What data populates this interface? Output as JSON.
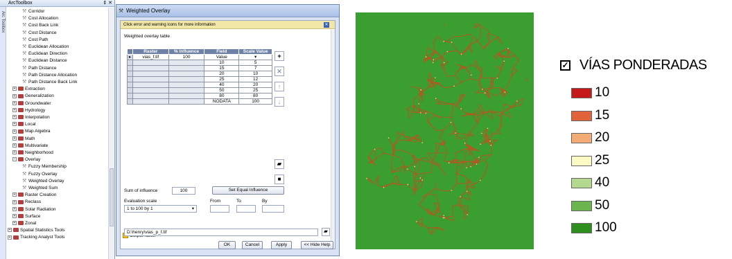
{
  "toolbox": {
    "title": "ArcToolbox",
    "pin": "⇕ ✕",
    "side_tab": "Arc Toolbox",
    "items": [
      {
        "label": "Corridor",
        "level": 2,
        "kind": "tool"
      },
      {
        "label": "Cost Allocation",
        "level": 2,
        "kind": "tool"
      },
      {
        "label": "Cost Back Link",
        "level": 2,
        "kind": "tool"
      },
      {
        "label": "Cost Distance",
        "level": 2,
        "kind": "tool"
      },
      {
        "label": "Cost Path",
        "level": 2,
        "kind": "tool"
      },
      {
        "label": "Euclidean Allocation",
        "level": 2,
        "kind": "tool"
      },
      {
        "label": "Euclidean Direction",
        "level": 2,
        "kind": "tool"
      },
      {
        "label": "Euclidean Distance",
        "level": 2,
        "kind": "tool"
      },
      {
        "label": "Path Distance",
        "level": 2,
        "kind": "tool"
      },
      {
        "label": "Path Distance Allocation",
        "level": 2,
        "kind": "tool"
      },
      {
        "label": "Path Distance Back Link",
        "level": 2,
        "kind": "tool"
      },
      {
        "label": "Extraction",
        "level": 1,
        "kind": "toolset"
      },
      {
        "label": "Generalization",
        "level": 1,
        "kind": "toolset"
      },
      {
        "label": "Groundwater",
        "level": 1,
        "kind": "toolset"
      },
      {
        "label": "Hydrology",
        "level": 1,
        "kind": "toolset"
      },
      {
        "label": "Interpolation",
        "level": 1,
        "kind": "toolset"
      },
      {
        "label": "Local",
        "level": 1,
        "kind": "toolset"
      },
      {
        "label": "Map Algebra",
        "level": 1,
        "kind": "toolset"
      },
      {
        "label": "Math",
        "level": 1,
        "kind": "toolset"
      },
      {
        "label": "Multivariate",
        "level": 1,
        "kind": "toolset"
      },
      {
        "label": "Neighborhood",
        "level": 1,
        "kind": "toolset"
      },
      {
        "label": "Overlay",
        "level": 1,
        "kind": "toolset-open"
      },
      {
        "label": "Fuzzy Membership",
        "level": 2,
        "kind": "tool"
      },
      {
        "label": "Fuzzy Overlay",
        "level": 2,
        "kind": "tool"
      },
      {
        "label": "Weighted Overlay",
        "level": 2,
        "kind": "tool"
      },
      {
        "label": "Weighted Sum",
        "level": 2,
        "kind": "tool"
      },
      {
        "label": "Raster Creation",
        "level": 1,
        "kind": "toolset"
      },
      {
        "label": "Reclass",
        "level": 1,
        "kind": "toolset"
      },
      {
        "label": "Solar Radiation",
        "level": 1,
        "kind": "toolset"
      },
      {
        "label": "Surface",
        "level": 1,
        "kind": "toolset"
      },
      {
        "label": "Zonal",
        "level": 1,
        "kind": "toolset"
      },
      {
        "label": "Spatial Statistics Tools",
        "level": 0,
        "kind": "toolbox"
      },
      {
        "label": "Tracking Analyst Tools",
        "level": 0,
        "kind": "toolbox"
      }
    ]
  },
  "dialog": {
    "title": "Weighted Overlay",
    "infobar": "Click error and warning icons for more information",
    "table_label": "Weighted overlay table",
    "columns": [
      "Raster",
      "% Influence",
      "Field",
      "Scale Value"
    ],
    "value_header": "Value",
    "raster_row": {
      "raster": "vias_f.tif",
      "influence": "100"
    },
    "rows": [
      {
        "field": "10",
        "scale": "5"
      },
      {
        "field": "15",
        "scale": "7"
      },
      {
        "field": "20",
        "scale": "10"
      },
      {
        "field": "25",
        "scale": "12"
      },
      {
        "field": "40",
        "scale": "20"
      },
      {
        "field": "50",
        "scale": "25"
      },
      {
        "field": "80",
        "scale": "80"
      },
      {
        "field": "NODATA",
        "scale": "100"
      }
    ],
    "sum_label": "Sum of influence",
    "sum_value": "100",
    "set_equal_button": "Set Equal Influence",
    "eval_label": "Evaluation scale",
    "eval_value": "1  to  100  by  1",
    "from_label": "From",
    "to_label": "To",
    "by_label": "By",
    "output_label": "Output raster",
    "output_path": "D:\\henry\\vias_p_f.tif",
    "buttons": {
      "ok": "OK",
      "cancel": "Cancel",
      "apply": "Apply",
      "hide_help": "<< Hide Help"
    }
  },
  "legend": {
    "title": "VÍAS PONDERADAS",
    "items": [
      {
        "label": "10",
        "color": "#c51a1a"
      },
      {
        "label": "15",
        "color": "#e2623a"
      },
      {
        "label": "20",
        "color": "#f2ab74"
      },
      {
        "label": "25",
        "color": "#fdfbc4"
      },
      {
        "label": "40",
        "color": "#b2d98d"
      },
      {
        "label": "50",
        "color": "#6bb54f"
      },
      {
        "label": "100",
        "color": "#2f8f1e"
      }
    ]
  },
  "colors": {
    "map_background": "#3a9e30",
    "roads": "#b5581f"
  }
}
